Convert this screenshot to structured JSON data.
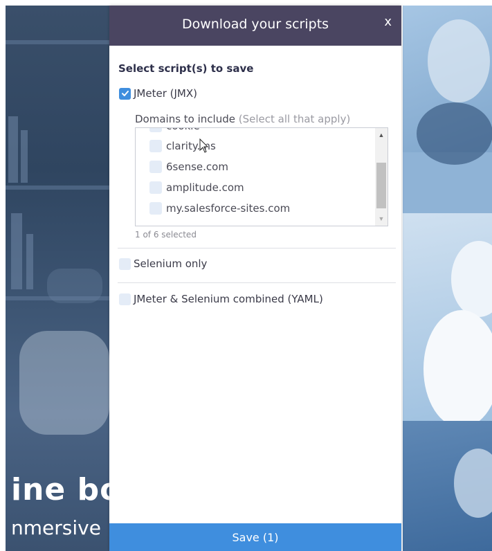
{
  "background": {
    "headline_fragment": "ine bo",
    "subline_fragment": "nmersive"
  },
  "modal": {
    "title": "Download your scripts",
    "close_label": "x",
    "section_label": "Select script(s) to save",
    "options": [
      {
        "label": "JMeter (JMX)",
        "checked": true
      },
      {
        "label": "Selenium only",
        "checked": false
      },
      {
        "label": "JMeter & Selenium combined (YAML)",
        "checked": false
      }
    ],
    "domains": {
      "label": "Domains to include",
      "hint": "(Select all that apply)",
      "partial_item": "cookie",
      "items": [
        {
          "label": "clarity.ms",
          "checked": false
        },
        {
          "label": "6sense.com",
          "checked": false
        },
        {
          "label": "amplitude.com",
          "checked": false
        },
        {
          "label": "my.salesforce-sites.com",
          "checked": false
        }
      ],
      "selected_count": "1 of 6 selected"
    },
    "save_label": "Save (1)"
  },
  "colors": {
    "header": "#4a4561",
    "accent": "#3f8ede",
    "checkbox_unchecked": "#e4ecf7"
  },
  "icons": [
    "check-icon",
    "close-icon",
    "scroll-up-icon",
    "scroll-down-icon",
    "mouse-cursor-icon"
  ]
}
